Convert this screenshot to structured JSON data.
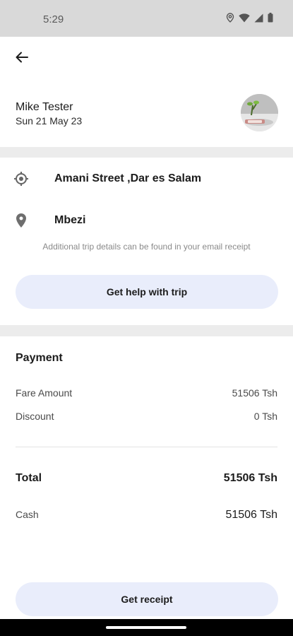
{
  "status_bar": {
    "time": "5:29",
    "icons": [
      "location-icon",
      "wifi-icon",
      "signal-icon",
      "battery-icon"
    ]
  },
  "header": {
    "back_icon": "arrow-left-icon"
  },
  "trip": {
    "driver_name": "Mike Tester",
    "date": "Sun 21 May 23"
  },
  "locations": {
    "pickup": "Amani Street ,Dar es Salam",
    "dropoff": "Mbezi",
    "note": "Additional trip details can be found in your email receipt",
    "help_button": "Get help with trip"
  },
  "payment": {
    "title": "Payment",
    "fare_label": "Fare Amount",
    "fare_value": "51506 Tsh",
    "discount_label": "Discount",
    "discount_value": "0 Tsh",
    "total_label": "Total",
    "total_value": "51506 Tsh",
    "cash_label": "Cash",
    "cash_value": "51506 Tsh"
  },
  "receipt_button": "Get receipt",
  "colors": {
    "button_bg": "#e9edfb",
    "band_bg": "#ececec",
    "status_bar_bg": "#d9d9d9"
  }
}
